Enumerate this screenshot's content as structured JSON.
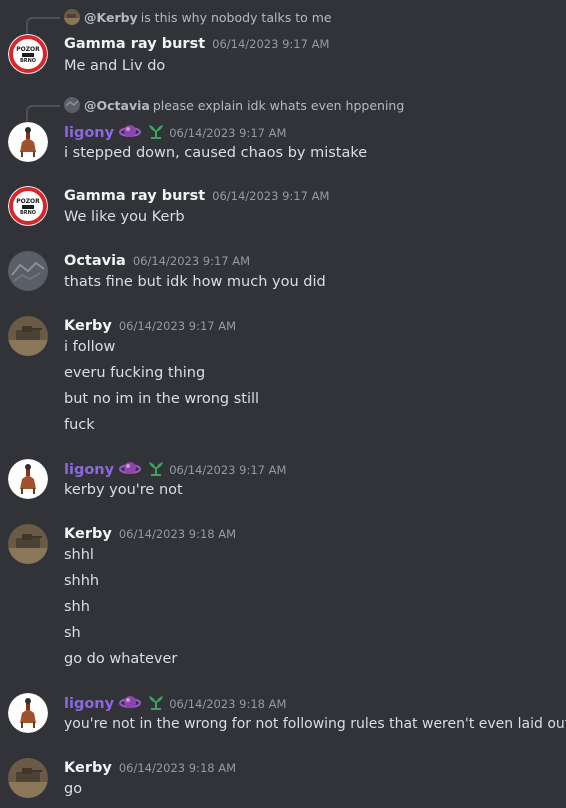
{
  "colors": {
    "background": "#313338",
    "name_default": "#f2f3f5",
    "name_purple": "#8e67e0",
    "text": "#dbdee1",
    "muted": "#949ba4"
  },
  "messages": [
    {
      "reply": {
        "author": "@Kerby",
        "text": "is this why nobody talks to me"
      },
      "author": "Gamma ray burst",
      "timestamp": "06/14/2023 9:17 AM",
      "lines": [
        "Me and Liv do"
      ]
    },
    {
      "reply": {
        "author": "@Octavia",
        "text": "please explain idk whats even hppening"
      },
      "author": "ligony",
      "timestamp": "06/14/2023 9:17 AM",
      "lines": [
        "i stepped down, caused chaos by mistake"
      ]
    },
    {
      "author": "Gamma ray burst",
      "timestamp": "06/14/2023 9:17 AM",
      "lines": [
        "We like you Kerb"
      ]
    },
    {
      "author": "Octavia",
      "timestamp": "06/14/2023 9:17 AM",
      "lines": [
        "thats fine but idk how much you did"
      ]
    },
    {
      "author": "Kerby",
      "timestamp": "06/14/2023 9:17 AM",
      "lines": [
        "i follow",
        "everu fucking thing",
        "but no im in the wrong still",
        "fuck"
      ]
    },
    {
      "author": "ligony",
      "timestamp": "06/14/2023 9:17 AM",
      "lines": [
        "kerby you're not"
      ]
    },
    {
      "author": "Kerby",
      "timestamp": "06/14/2023 9:18 AM",
      "lines": [
        "shhl",
        "shhh",
        "shh",
        "sh",
        "go do whatever"
      ]
    },
    {
      "author": "ligony",
      "timestamp": "06/14/2023 9:18 AM",
      "lines": [
        "you're not in the wrong for not following rules that weren't even laid out"
      ]
    },
    {
      "author": "Kerby",
      "timestamp": "06/14/2023 9:18 AM",
      "lines": [
        "go"
      ]
    }
  ],
  "avatar_texts": {
    "pozor": "POZOR",
    "brno": "BRNO"
  }
}
